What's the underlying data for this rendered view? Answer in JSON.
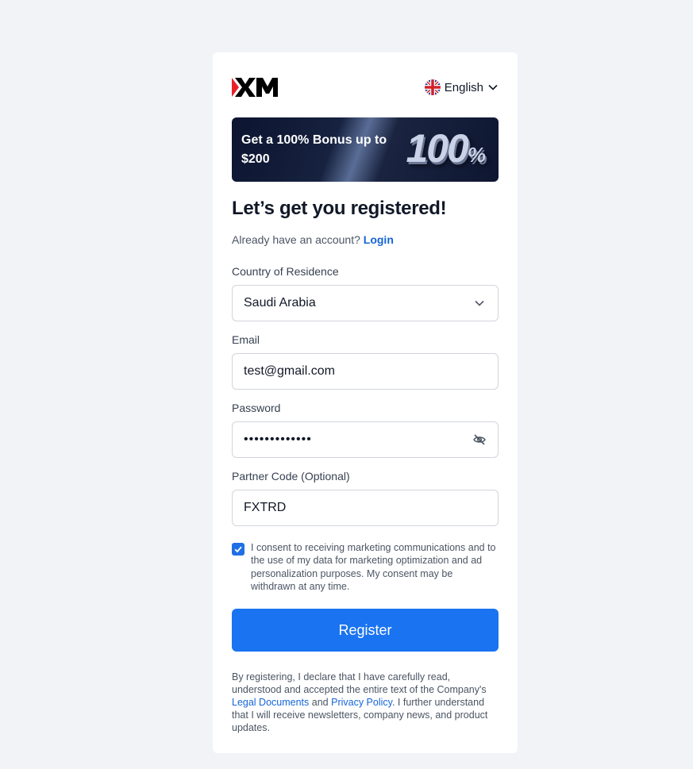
{
  "header": {
    "language": "English"
  },
  "banner": {
    "text": "Get a 100% Bonus up to $200",
    "big_number": "100",
    "big_percent": "%"
  },
  "page": {
    "title": "Let’s get you registered!",
    "already_text": "Already have an account?",
    "login_link": "Login"
  },
  "form": {
    "country_label": "Country of Residence",
    "country_value": "Saudi Arabia",
    "email_label": "Email",
    "email_value": "test@gmail.com",
    "password_label": "Password",
    "password_value": "•••••••••••••",
    "partner_label": "Partner Code (Optional)",
    "partner_value": "FXTRD",
    "consent_text": "I consent to receiving marketing communications and to the use of my data for marketing optimization and ad personalization purposes. My consent may be withdrawn at any time.",
    "consent_checked": true,
    "register_label": "Register"
  },
  "legal": {
    "part1": "By registering, I declare that I have carefully read, understood and accepted the entire text of the Company's",
    "link1": "Legal Documents",
    "and": "and",
    "link2": "Privacy Policy",
    "part2": ". I further understand that I will receive newsletters, company news, and product updates."
  },
  "colors": {
    "accent": "#1a73f0",
    "link": "#1565d8",
    "background": "#f2f3f7"
  },
  "icons": {
    "country_dropdown": "chevron-down-icon",
    "password_toggle": "eye-off-icon",
    "language_flag": "uk-flag-icon"
  }
}
